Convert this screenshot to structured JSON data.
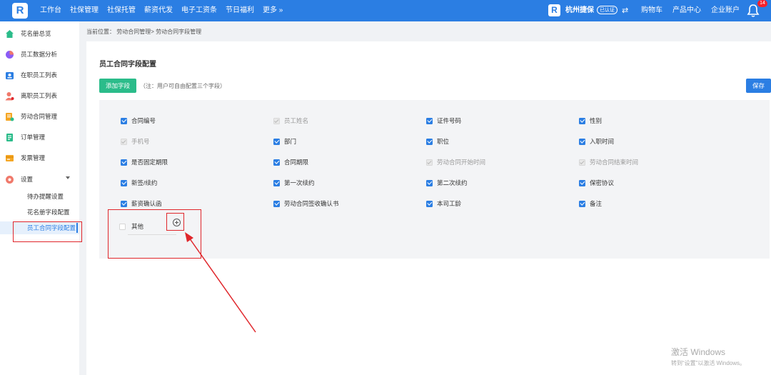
{
  "topbar": {
    "logo_text": "R",
    "nav": [
      "工作台",
      "社保管理",
      "社保托管",
      "薪资代发",
      "电子工资条",
      "节日福利",
      "更多 »"
    ],
    "company_logo": "R",
    "company_name": "杭州捷保",
    "verified_badge": "已认证",
    "switch_icon": "swap-icon",
    "links": [
      "购物车",
      "产品中心",
      "企业账户"
    ],
    "bell_icon": "bell-icon",
    "notification_count": "14",
    "color": "#2b7ee3"
  },
  "sidebar": {
    "items": [
      {
        "label": "花名册总览",
        "icon": "home-icon",
        "color": "#2bbc8a"
      },
      {
        "label": "员工数据分析",
        "icon": "pie-chart-icon",
        "color": "#8b5cf6"
      },
      {
        "label": "在职员工列表",
        "icon": "id-card-icon",
        "color": "#2b7ee3"
      },
      {
        "label": "离职员工列表",
        "icon": "user-leave-icon",
        "color": "#f0796b"
      },
      {
        "label": "劳动合同管理",
        "icon": "contract-icon",
        "color": "#f5a623"
      },
      {
        "label": "订单管理",
        "icon": "order-icon",
        "color": "#2bbc8a"
      },
      {
        "label": "发票管理",
        "icon": "invoice-icon",
        "color": "#f5a623"
      },
      {
        "label": "设置",
        "icon": "settings-icon",
        "color": "#f0796b"
      }
    ],
    "settings_sub": [
      {
        "label": "待办提醒设置"
      },
      {
        "label": "花名册字段配置"
      },
      {
        "label": "员工合同字段配置",
        "active": true
      }
    ]
  },
  "breadcrumb": "当前位置：  劳动合同管理>  劳动合同字段管理",
  "panel": {
    "title": "员工合同字段配置",
    "add_button": "添加字段",
    "hint": "（注：用户可自由配置三个字段）",
    "save_button": "保存"
  },
  "fields": [
    [
      {
        "label": "合同编号",
        "state": "checked"
      },
      {
        "label": "员工姓名",
        "state": "disabled"
      },
      {
        "label": "证件号码",
        "state": "checked"
      },
      {
        "label": "性别",
        "state": "checked"
      }
    ],
    [
      {
        "label": "手机号",
        "state": "disabled"
      },
      {
        "label": "部门",
        "state": "checked"
      },
      {
        "label": "职位",
        "state": "checked"
      },
      {
        "label": "入职时间",
        "state": "checked"
      }
    ],
    [
      {
        "label": "是否固定期限",
        "state": "checked"
      },
      {
        "label": "合同期限",
        "state": "checked"
      },
      {
        "label": "劳动合同开始时间",
        "state": "disabled"
      },
      {
        "label": "劳动合同结束时间",
        "state": "disabled"
      }
    ],
    [
      {
        "label": "新签/续约",
        "state": "checked"
      },
      {
        "label": "第一次续约",
        "state": "checked"
      },
      {
        "label": "第二次续约",
        "state": "checked"
      },
      {
        "label": "保密协议",
        "state": "checked"
      }
    ],
    [
      {
        "label": "薪资确认函",
        "state": "checked"
      },
      {
        "label": "劳动合同签收确认书",
        "state": "checked"
      },
      {
        "label": "本司工龄",
        "state": "checked"
      },
      {
        "label": "备注",
        "state": "checked"
      }
    ]
  ],
  "custom_field": {
    "label": "其他",
    "state": "unchecked",
    "add_icon": "plus-circle-icon"
  },
  "annotation_color": "#e0262b",
  "watermark": {
    "line1": "激活 Windows",
    "line2": "转到“设置”以激活 Windows。"
  }
}
